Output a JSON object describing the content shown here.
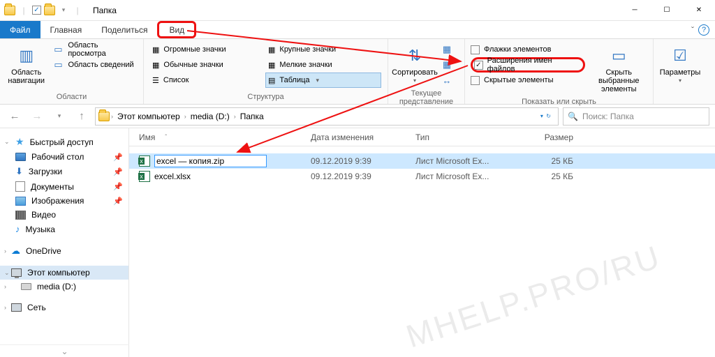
{
  "window": {
    "title": "Папка"
  },
  "tabs": {
    "file": "Файл",
    "home": "Главная",
    "share": "Поделиться",
    "view": "Вид"
  },
  "ribbon": {
    "panes": {
      "nav": "Область\nнавигации",
      "preview": "Область просмотра",
      "details": "Область сведений",
      "group_label": "Области"
    },
    "layouts": {
      "huge": "Огромные значки",
      "large": "Крупные значки",
      "normal": "Обычные значки",
      "small": "Мелкие значки",
      "list": "Список",
      "table": "Таблица",
      "group_label": "Структура"
    },
    "view": {
      "sort": "Сортировать",
      "group_label": "Текущее представление"
    },
    "showhide": {
      "checkboxes": "Флажки элементов",
      "extensions": "Расширения имен файлов",
      "hidden": "Скрытые элементы",
      "hide_sel": "Скрыть выбранные\nэлементы",
      "group_label": "Показать или скрыть"
    },
    "options": "Параметры"
  },
  "address": {
    "segments": [
      "Этот компьютер",
      "media (D:)",
      "Папка"
    ],
    "search_placeholder": "Поиск: Папка"
  },
  "nav": {
    "quick": "Быстрый доступ",
    "desktop": "Рабочий стол",
    "downloads": "Загрузки",
    "documents": "Документы",
    "pictures": "Изображения",
    "videos": "Видео",
    "music": "Музыка",
    "onedrive": "OneDrive",
    "thispc": "Этот компьютер",
    "drive": "media (D:)",
    "network": "Сеть"
  },
  "columns": {
    "name": "Имя",
    "date": "Дата изменения",
    "type": "Тип",
    "size": "Размер"
  },
  "files": [
    {
      "name": "excel — копия.zip",
      "date": "09.12.2019 9:39",
      "type": "Лист Microsoft Ex...",
      "size": "25 КБ",
      "editing": true
    },
    {
      "name": "excel.xlsx",
      "date": "09.12.2019 9:39",
      "type": "Лист Microsoft Ex...",
      "size": "25 КБ",
      "editing": false
    }
  ],
  "watermark": "MHELP.PRO/RU"
}
